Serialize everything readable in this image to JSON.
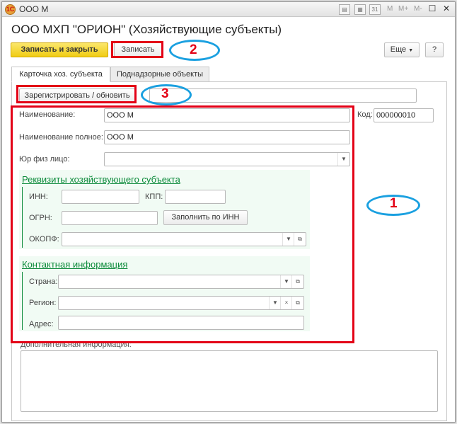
{
  "window": {
    "title": "ООО М",
    "mem_buttons": [
      "M",
      "M+",
      "M-"
    ]
  },
  "form": {
    "title": "ООО МХП \"ОРИОН\" (Хозяйствующие субъекты)"
  },
  "toolbar": {
    "save_close": "Записать и закрыть",
    "save": "Записать",
    "more": "Еще",
    "help": "?"
  },
  "tabs": [
    "Карточка хоз. субъекта",
    "Поднадзорные объекты"
  ],
  "register_button": "Зарегистрировать / обновить",
  "fields": {
    "name": {
      "label": "Наименование:",
      "value": "ООО М"
    },
    "code": {
      "label": "Код:",
      "value": "000000010"
    },
    "full_name": {
      "label": "Наименование полное:",
      "value": "ООО М"
    },
    "legal_type": {
      "label": "Юр физ лицо:",
      "value": ""
    }
  },
  "requisites": {
    "title": "Реквизиты хозяйствующего субъекта",
    "inn_label": "ИНН:",
    "kpp_label": "КПП:",
    "ogrn_label": "ОГРН:",
    "fill_button": "Заполнить по ИНН",
    "okopf_label": "ОКОПФ:"
  },
  "contact": {
    "title": "Контактная информация",
    "country_label": "Страна:",
    "region_label": "Регион:",
    "address_label": "Адрес:"
  },
  "additional": {
    "label": "Дополнительная информация:"
  },
  "annotations": {
    "n1": "1",
    "n2": "2",
    "n3": "3"
  },
  "colors": {
    "annotation_red": "#e30016",
    "annotation_blue": "#1aa0e0",
    "group_green": "#0b8a3a",
    "primary_yellow": "#f0cc14"
  }
}
